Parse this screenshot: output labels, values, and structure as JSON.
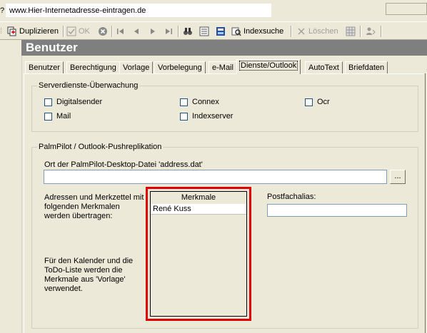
{
  "address_bar": {
    "icon": "?",
    "url": "www.Hier-Internetadresse-eintragen.de"
  },
  "toolbar": {
    "duplicate": "Duplizieren",
    "ok": "OK",
    "index_search": "Indexsuche",
    "delete": "Löschen"
  },
  "page_title": "Benutzer",
  "tabs": [
    {
      "label": "Benutzer"
    },
    {
      "label": "Berechtigung"
    },
    {
      "label": "Vorlage"
    },
    {
      "label": "Vorbelegung"
    },
    {
      "label": "e-Mail"
    },
    {
      "label": "Dienste/Outlook",
      "active": true
    },
    {
      "label": "AutoText"
    },
    {
      "label": "Briefdaten"
    }
  ],
  "server_services": {
    "legend": "Serverdienste-Überwachung",
    "checkboxes": [
      {
        "label": "Digitalsender",
        "checked": false
      },
      {
        "label": "Connex",
        "checked": false
      },
      {
        "label": "Ocr",
        "checked": false
      },
      {
        "label": "Mail",
        "checked": false
      },
      {
        "label": "Indexserver",
        "checked": false
      }
    ]
  },
  "palmpilot": {
    "legend": "PalmPilot / Outlook-Pushreplikation",
    "file_label": "Ort der PalmPilot-Desktop-Datei 'address.dat'",
    "file_value": "",
    "browse_label": "...",
    "transfer_text": "Adressen und Merkzettel mit folgenden Merkmalen werden übertragen:",
    "calendar_text": "Für den Kalender und die ToDo-Liste werden die Merkmale aus 'Vorlage' verwendet.",
    "merkmale_header": "Merkmale",
    "merkmale_items": [
      "René Kuss"
    ],
    "postfach_label": "Postfachalias:",
    "postfach_value": ""
  },
  "colors": {
    "highlight": "#e00000",
    "title_band": "#7f7f7f",
    "background": "#ece9d8"
  }
}
